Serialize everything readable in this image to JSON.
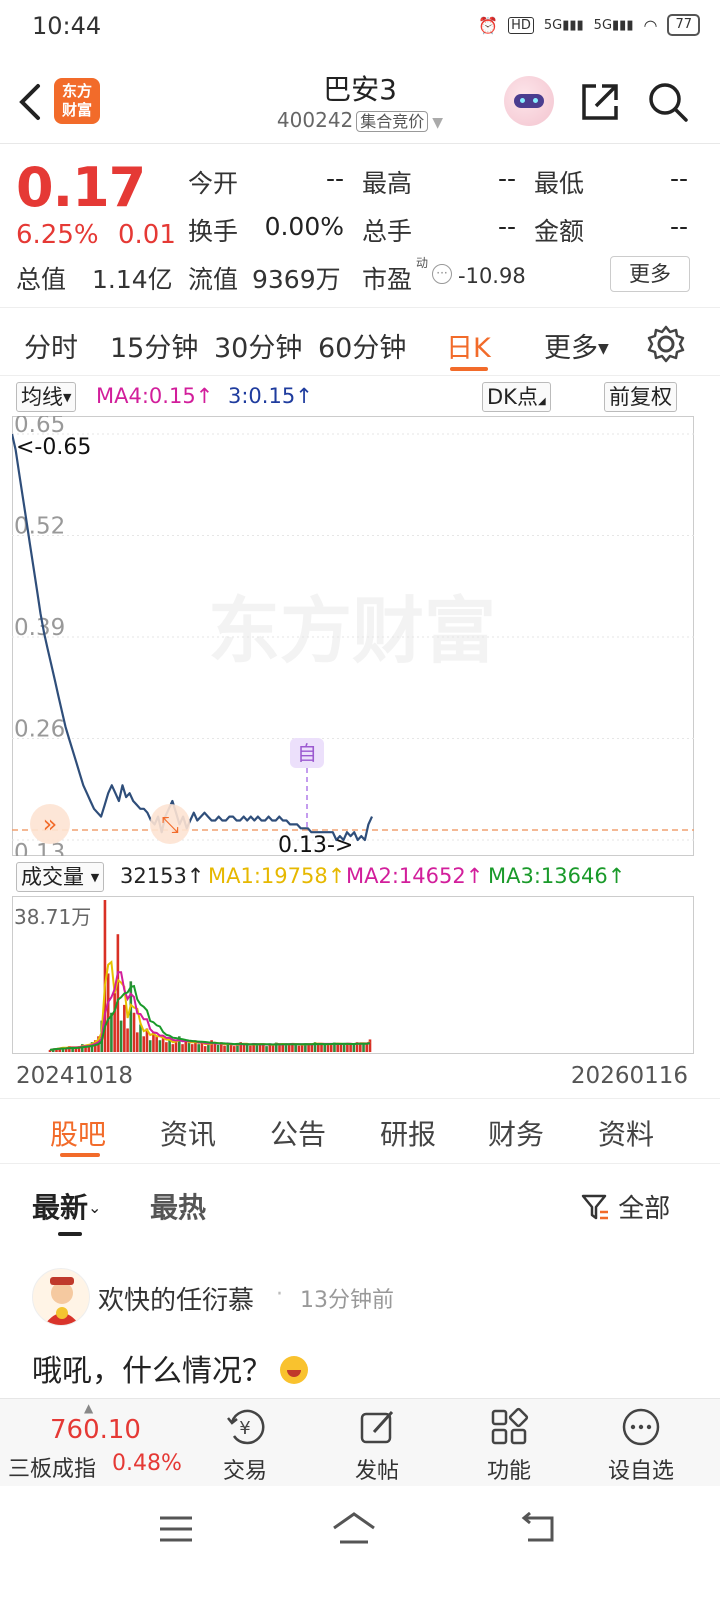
{
  "status_bar": {
    "time": "10:44",
    "battery": "77"
  },
  "nav": {
    "title": "巴安3",
    "code": "400242",
    "tag": "集合竞价",
    "logo_line1": "东方",
    "logo_line2": "财富"
  },
  "quote": {
    "price": "0.17",
    "change_pct": "6.25%",
    "change": "0.01",
    "open_label": "今开",
    "open": "--",
    "high_label": "最高",
    "high": "--",
    "low_label": "最低",
    "low": "--",
    "turnover_label": "换手",
    "turnover": "0.00%",
    "volume_label": "总手",
    "volume": "--",
    "amount_label": "金额",
    "amount": "--",
    "mktcap_label": "总值",
    "mktcap": "1.14亿",
    "float_label": "流值",
    "float": "9369万",
    "pe_label": "市盈",
    "pe_sup": "动",
    "pe": "-10.98",
    "more": "更多"
  },
  "period_tabs": [
    "分时",
    "15分钟",
    "30分钟",
    "60分钟",
    "日K",
    "更多"
  ],
  "kline_header": {
    "ma_select": "均线",
    "ma4": "MA4:0.15↑",
    "ma3": "3:0.15↑",
    "dk": "DK点",
    "adjust": "前复权"
  },
  "volume_header": {
    "select": "成交量",
    "vol": "32153↑",
    "ma1": "MA1:19758↑",
    "ma2": "MA2:14652↑",
    "ma3": "MA3:13646↑"
  },
  "chart_data": {
    "type": "line",
    "title": "",
    "y_ticks": [
      "0.65",
      "0.52",
      "0.39",
      "0.26",
      "0.13"
    ],
    "ylim": [
      0.13,
      0.65
    ],
    "max_label": "<-0.65",
    "min_label": "0.13->",
    "marker_label": "自",
    "watermark": "东方财富",
    "x_start": "20241018",
    "x_end": "20260116",
    "price_series": [
      0.65,
      0.63,
      0.6,
      0.57,
      0.54,
      0.51,
      0.48,
      0.45,
      0.42,
      0.395,
      0.375,
      0.355,
      0.335,
      0.315,
      0.295,
      0.275,
      0.26,
      0.245,
      0.23,
      0.215,
      0.2,
      0.19,
      0.18,
      0.17,
      0.165,
      0.16,
      0.175,
      0.19,
      0.2,
      0.19,
      0.18,
      0.2,
      0.185,
      0.19,
      0.18,
      0.175,
      0.17,
      0.17,
      0.165,
      0.155,
      0.15,
      0.16,
      0.14,
      0.16,
      0.17,
      0.18,
      0.165,
      0.15,
      0.16,
      0.145,
      0.155,
      0.165,
      0.155,
      0.16,
      0.165,
      0.16,
      0.155,
      0.155,
      0.16,
      0.155,
      0.155,
      0.16,
      0.16,
      0.155,
      0.155,
      0.16,
      0.155,
      0.16,
      0.155,
      0.16,
      0.155,
      0.155,
      0.16,
      0.155,
      0.155,
      0.16,
      0.155,
      0.155,
      0.15,
      0.15,
      0.15,
      0.145,
      0.145,
      0.145,
      0.14,
      0.14,
      0.14,
      0.14,
      0.14,
      0.14,
      0.14,
      0.13,
      0.135,
      0.13,
      0.14,
      0.135,
      0.14,
      0.13,
      0.135,
      0.13,
      0.15,
      0.16
    ],
    "volume_max_label": "38.71万",
    "volume_series": [
      0.5,
      0.8,
      1,
      1,
      1.2,
      1,
      1.5,
      1.2,
      1,
      1.5,
      2,
      1.5,
      2,
      2.5,
      3,
      4,
      8,
      38.71,
      20,
      10,
      15,
      30,
      8,
      12,
      6,
      18,
      10,
      5,
      7,
      4,
      6,
      3,
      5,
      4,
      3,
      4,
      2.5,
      3,
      2,
      3,
      4,
      2,
      3,
      2.5,
      2,
      3,
      2,
      2.5,
      1.5,
      2,
      3,
      2,
      1.8,
      2.5,
      1.6,
      2.2,
      2,
      1.5,
      2,
      2.5,
      1.8,
      2,
      1.6,
      2.3,
      1.8,
      2,
      2.2,
      1.5,
      2,
      1.9,
      2.4,
      1.7,
      2,
      2.1,
      1.8,
      2.3,
      2,
      1.6,
      2,
      2.2,
      1.8,
      2,
      2.5,
      1.9,
      2,
      2.2,
      1.8,
      2,
      2.4,
      2,
      1.9,
      2.1,
      2.3,
      1.8,
      2,
      2.5,
      2.2,
      2,
      2.4,
      3.2
    ]
  },
  "content_tabs": [
    "股吧",
    "资讯",
    "公告",
    "研报",
    "财务",
    "资料"
  ],
  "sort_tabs": {
    "latest": "最新",
    "hot": "最热",
    "filter": "全部"
  },
  "post": {
    "user": "欢快的任衍慕",
    "time": "13分钟前",
    "text": "哦吼，什么情况？"
  },
  "bottom_bar": {
    "index_value": "760.10",
    "index_name": "三板成指",
    "index_pct": "0.48%",
    "trade": "交易",
    "post": "发帖",
    "functions": "功能",
    "watch": "设自选"
  }
}
